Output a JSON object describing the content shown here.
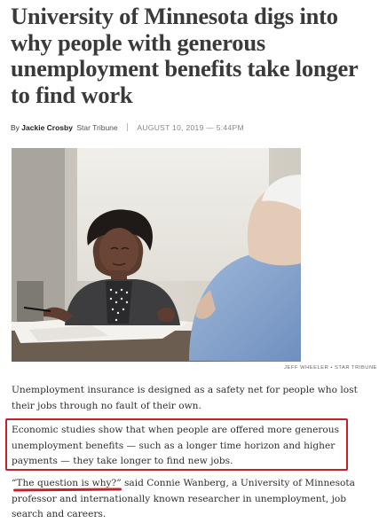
{
  "article": {
    "headline": "University of Minnesota digs into why people with generous unemployment benefits take longer to find work",
    "byline_prefix": "By",
    "author": "Jackie Crosby",
    "outlet": "Star Tribune",
    "date": "AUGUST 10, 2019 — 5:44PM",
    "photo_credit": "JEFF WHEELER • STAR TRIBUNE",
    "paragraphs": [
      "Unemployment insurance is designed as a safety net for people who lost their jobs through no fault of their own.",
      "Economic studies show that when people are offered more generous unemployment benefits — such as a longer time horizon and higher payments — they take longer to find new jobs.",
      "“The question is why?” said Connie Wanberg, a University of Minnesota professor and internationally known researcher in unemployment, job search and careers."
    ]
  },
  "annotations": {
    "box_color": "#c8202a",
    "underline_color": "#c8202a"
  }
}
